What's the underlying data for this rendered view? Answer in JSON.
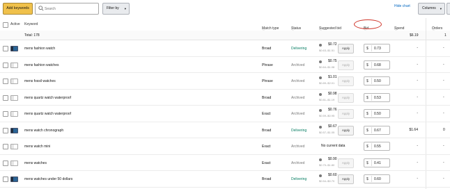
{
  "toolbar": {
    "add_keywords": "Add keywords",
    "search_placeholder": "Search",
    "filter_by": "Filter by",
    "hide_chart": "Hide chart",
    "columns": "Columns"
  },
  "headers": {
    "active": "Active",
    "keyword": "Keyword",
    "match_type": "Match type",
    "status": "Status",
    "suggested_bid": "Suggested bid",
    "bid": "Bid",
    "spend": "Spend",
    "orders": "Orders"
  },
  "total": {
    "label": "Total: 178",
    "spend": "$6.19",
    "orders": "1"
  },
  "rows": [
    {
      "keyword": "mens fashion watch",
      "match": "Broad",
      "status": "Delivering",
      "active": true,
      "sug": "$0.72",
      "range": "$0.63–$1.51",
      "apply_enabled": true,
      "bid": "0.73",
      "spend": "-",
      "orders": "-"
    },
    {
      "keyword": "mens fashion watches",
      "match": "Phrase",
      "status": "Archived",
      "active": false,
      "sug": "$0.75",
      "range": "$0.64–$1.08",
      "apply_enabled": false,
      "bid": "0.68",
      "spend": "-",
      "orders": "-"
    },
    {
      "keyword": "mens fossil watches",
      "match": "Phrase",
      "status": "Archived",
      "active": false,
      "sug": "$1.01",
      "range": "$0.89–$2.01",
      "apply_enabled": false,
      "bid": "0.50",
      "spend": "-",
      "orders": "-"
    },
    {
      "keyword": "mens quartz watch waterproof",
      "match": "Broad",
      "status": "Archived",
      "active": false,
      "sug": "$0.98",
      "range": "$0.81–$1.19",
      "apply_enabled": false,
      "bid": "0.53",
      "spend": "-",
      "orders": "-"
    },
    {
      "keyword": "mens quartz watch waterproof",
      "match": "Exact",
      "status": "Archived",
      "active": false,
      "sug": "$0.76",
      "range": "$0.59–$0.95",
      "apply_enabled": false,
      "bid": "0.50",
      "spend": "-",
      "orders": "-"
    },
    {
      "keyword": "mens watch chronograph",
      "match": "Broad",
      "status": "Delivering",
      "active": true,
      "sug": "$0.67",
      "range": "$0.57–$1.05",
      "apply_enabled": true,
      "bid": "0.67",
      "spend": "$1.64",
      "orders": "0"
    },
    {
      "keyword": "mens watch mini",
      "match": "Exact",
      "status": "Archived",
      "active": false,
      "no_data": "No current data",
      "bid": "0.55",
      "spend": "-",
      "orders": "-"
    },
    {
      "keyword": "mens watches",
      "match": "Exact",
      "status": "Archived",
      "active": false,
      "sug": "$0.90",
      "range": "$0.70–$1.80",
      "apply_enabled": false,
      "bid": "0.41",
      "spend": "-",
      "orders": "-"
    },
    {
      "keyword": "mens watches under 50 dollars",
      "match": "Broad",
      "status": "Delivering",
      "active": true,
      "sug": "$0.60",
      "range": "$0.54–$0.70",
      "apply_enabled": true,
      "bid": "0.60",
      "spend": "-",
      "orders": "-"
    }
  ],
  "apply_label": "Apply",
  "currency": "$",
  "colors": {
    "delivering": "#067d62",
    "archived": "#777777",
    "highlight_circle": "#d0352a",
    "primary_button": "#f0c14b"
  }
}
